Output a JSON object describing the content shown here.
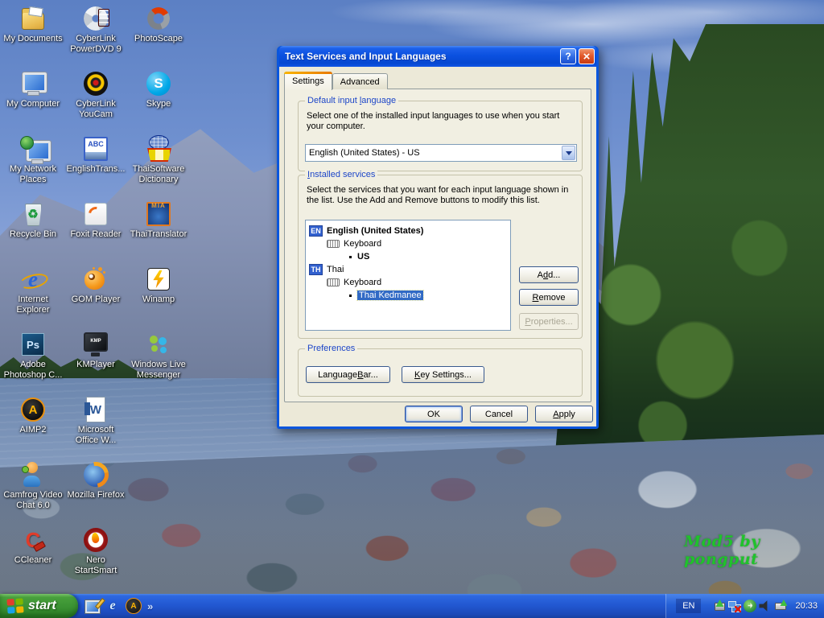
{
  "desktop": {
    "icons": [
      {
        "name": "my-documents",
        "label": "My Documents"
      },
      {
        "name": "cyberlink-powerdvd-9",
        "label": "CyberLink PowerDVD 9"
      },
      {
        "name": "photoscape",
        "label": "PhotoScape"
      },
      {
        "name": "my-computer",
        "label": "My Computer"
      },
      {
        "name": "cyberlink-youcam",
        "label": "CyberLink YouCam"
      },
      {
        "name": "skype",
        "label": "Skype",
        "glyph": "S"
      },
      {
        "name": "my-network-places",
        "label": "My Network Places"
      },
      {
        "name": "englishtrans",
        "label": "EnglishTrans...",
        "glyph": "ABC"
      },
      {
        "name": "thaisoftware-dictionary",
        "label": "ThaiSoftware Dictionary"
      },
      {
        "name": "recycle-bin",
        "label": "Recycle Bin",
        "glyph": "♻"
      },
      {
        "name": "foxit-reader",
        "label": "Foxit Reader"
      },
      {
        "name": "thaitranslator",
        "label": "ThaiTranslator",
        "glyph": "MIA"
      },
      {
        "name": "internet-explorer",
        "label": "Internet Explorer",
        "glyph": "e"
      },
      {
        "name": "gom-player",
        "label": "GOM Player"
      },
      {
        "name": "winamp",
        "label": "Winamp"
      },
      {
        "name": "adobe-photoshop",
        "label": "Adobe Photoshop C...",
        "glyph": "Ps"
      },
      {
        "name": "kmplayer",
        "label": "KMPlayer",
        "glyph": "KMP"
      },
      {
        "name": "windows-live-messenger",
        "label": "Windows Live Messenger"
      },
      {
        "name": "aimp2",
        "label": "AIMP2",
        "glyph": "A"
      },
      {
        "name": "microsoft-office-word",
        "label": "Microsoft Office W...",
        "glyph": "W"
      },
      {
        "name": "camfrog",
        "label": "Camfrog Video Chat 6.0"
      },
      {
        "name": "mozilla-firefox",
        "label": "Mozilla Firefox"
      },
      {
        "name": "ccleaner",
        "label": "CCleaner",
        "glyph": "C"
      },
      {
        "name": "nero-startsmart",
        "label": "Nero StartSmart"
      }
    ]
  },
  "dialog": {
    "title": "Text Services and Input Languages",
    "help_glyph": "?",
    "close_glyph": "×",
    "tabs": {
      "settings": "Settings",
      "advanced": "Advanced"
    },
    "default_group": {
      "caption": {
        "pre": "Default input ",
        "key": "l",
        "post": "anguage"
      },
      "description": "Select one of the installed input languages to use when you start your computer.",
      "value": "English (United States) - US"
    },
    "services_group": {
      "caption": {
        "key": "I",
        "post": "nstalled services"
      },
      "description": "Select the services that you want for each input language shown in the list. Use the Add and Remove buttons to modify this list.",
      "rows": {
        "en_badge": "EN",
        "en_label": "English (United States)",
        "en_keyboard": "Keyboard",
        "en_entry": "US",
        "th_badge": "TH",
        "th_label": "Thai",
        "th_keyboard": "Keyboard",
        "th_entry": "Thai Kedmanee"
      },
      "add": {
        "pre": "A",
        "key": "d",
        "post": "d..."
      },
      "remove": {
        "key": "R",
        "post": "emove"
      },
      "properties": {
        "key": "P",
        "post": "roperties..."
      }
    },
    "preferences_group": {
      "caption": "Preferences",
      "language_bar": {
        "pre": "Language ",
        "key": "B",
        "post": "ar..."
      },
      "key_settings": {
        "key": "K",
        "post": "ey Settings..."
      }
    },
    "footer": {
      "ok": "OK",
      "cancel": "Cancel",
      "apply": {
        "key": "A",
        "post": "pply"
      }
    }
  },
  "taskbar": {
    "start_label": "start",
    "overflow_glyph": "»",
    "quick_launch": {
      "ie_glyph": "e",
      "aimp_glyph": "A"
    },
    "tray": {
      "language": "EN",
      "time": "20:33"
    }
  },
  "watermark": {
    "text": "Mod5 by pongput"
  },
  "colors": {
    "selection": "#316ac5",
    "titlebar_blue": "#0b51e0",
    "taskbar_blue": "#2258d2",
    "start_green": "#3a9232",
    "group_caption_blue": "#1d46c8",
    "watermark_green": "#1fc32b"
  }
}
